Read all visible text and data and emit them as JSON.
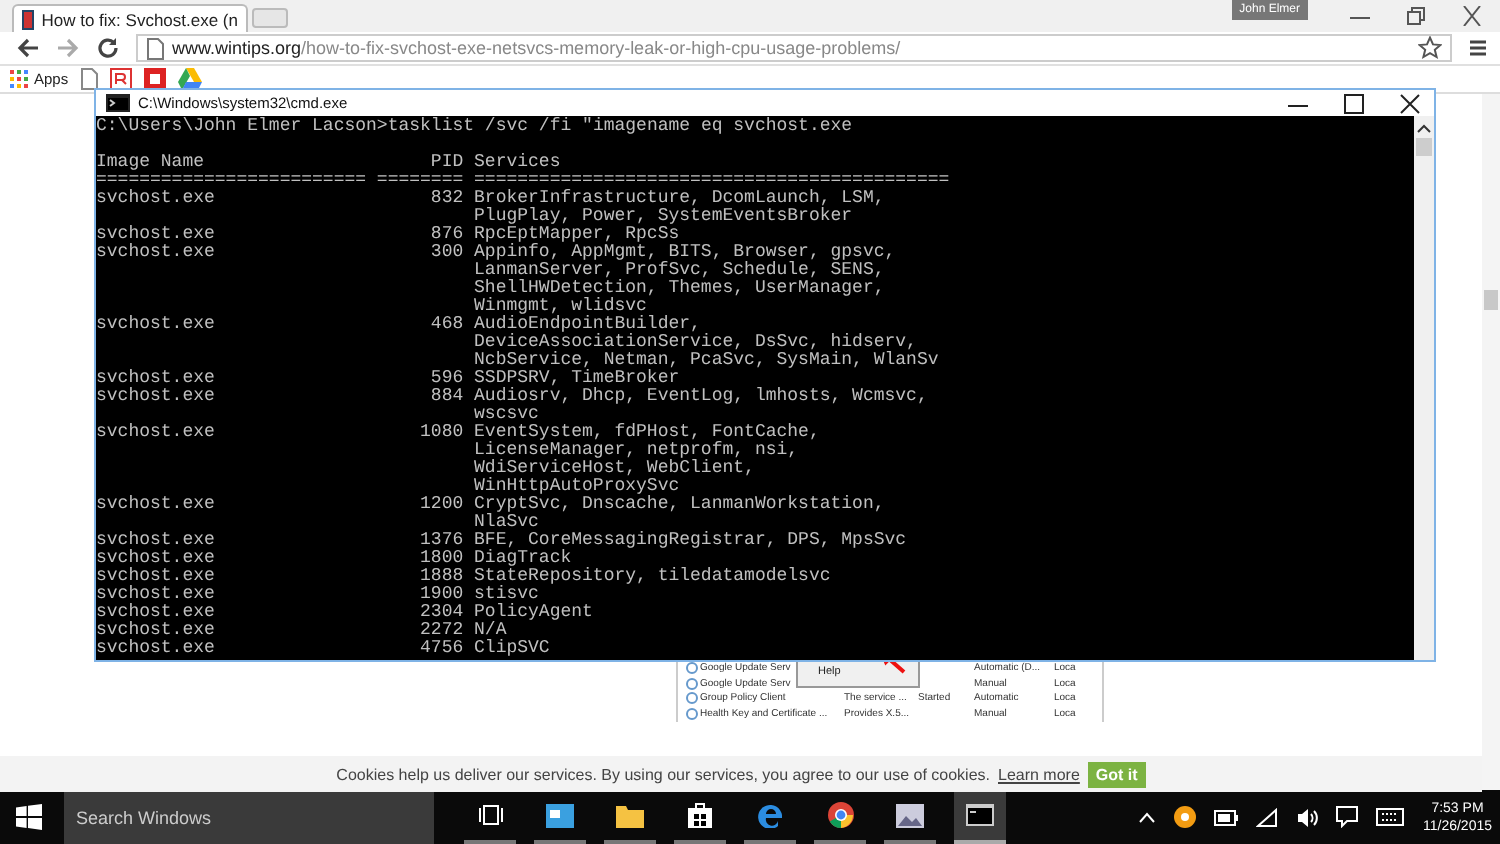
{
  "browser": {
    "tab": {
      "title": "How to fix: Svchost.exe (n"
    },
    "profile": "John Elmer",
    "address": {
      "domain": "www.wintips.org",
      "path": "/how-to-fix-svchost-exe-netsvcs-memory-leak-or-high-cpu-usage-problems/"
    },
    "bookmarks": {
      "apps_label": "Apps"
    }
  },
  "page": {
    "services_list": [
      {
        "name": "Google Update Serv",
        "startup": "Automatic (D...",
        "logon": "Loca"
      },
      {
        "name": "Google Update Serv",
        "startup": "Manual",
        "logon": "Loca"
      },
      {
        "name": "Group Policy Client",
        "description": "The service ...",
        "status": "Started",
        "startup": "Automatic",
        "logon": "Loca"
      },
      {
        "name": "Health Key and Certificate ...",
        "description": "Provides X.5...",
        "startup": "Manual",
        "logon": "Loca"
      }
    ],
    "context_menu": [
      "Help"
    ],
    "cookie_bar": {
      "text": "Cookies help us deliver our services. By using our services, you agree to our use of cookies.",
      "link": "Learn more",
      "button": "Got it"
    }
  },
  "cmd_window": {
    "title": "C:\\Windows\\system32\\cmd.exe",
    "prompt": "C:\\Users\\John Elmer Lacson>tasklist /svc /fi \"imagename eq svchost.exe",
    "columns": [
      "Image Name",
      "PID",
      "Services"
    ],
    "separators": [
      "=========================",
      "========",
      "============================================"
    ],
    "rows": [
      {
        "image": "svchost.exe",
        "pid": "832",
        "services": [
          "BrokerInfrastructure, DcomLaunch, LSM,",
          "PlugPlay, Power, SystemEventsBroker"
        ]
      },
      {
        "image": "svchost.exe",
        "pid": "876",
        "services": [
          "RpcEptMapper, RpcSs"
        ]
      },
      {
        "image": "svchost.exe",
        "pid": "300",
        "services": [
          "Appinfo, AppMgmt, BITS, Browser, gpsvc,",
          "LanmanServer, ProfSvc, Schedule, SENS,",
          "ShellHWDetection, Themes, UserManager,",
          "Winmgmt, wlidsvc"
        ]
      },
      {
        "image": "svchost.exe",
        "pid": "468",
        "services": [
          "AudioEndpointBuilder,",
          "DeviceAssociationService, DsSvc, hidserv,",
          "NcbService, Netman, PcaSvc, SysMain, WlanSv"
        ]
      },
      {
        "image": "svchost.exe",
        "pid": "596",
        "services": [
          "SSDPSRV, TimeBroker"
        ]
      },
      {
        "image": "svchost.exe",
        "pid": "884",
        "services": [
          "Audiosrv, Dhcp, EventLog, lmhosts, Wcmsvc,",
          "wscsvc"
        ]
      },
      {
        "image": "svchost.exe",
        "pid": "1080",
        "services": [
          "EventSystem, fdPHost, FontCache,",
          "LicenseManager, netprofm, nsi,",
          "WdiServiceHost, WebClient,",
          "WinHttpAutoProxySvc"
        ]
      },
      {
        "image": "svchost.exe",
        "pid": "1200",
        "services": [
          "CryptSvc, Dnscache, LanmanWorkstation,",
          "NlaSvc"
        ]
      },
      {
        "image": "svchost.exe",
        "pid": "1376",
        "services": [
          "BFE, CoreMessagingRegistrar, DPS, MpsSvc"
        ]
      },
      {
        "image": "svchost.exe",
        "pid": "1800",
        "services": [
          "DiagTrack"
        ]
      },
      {
        "image": "svchost.exe",
        "pid": "1888",
        "services": [
          "StateRepository, tiledatamodelsvc"
        ]
      },
      {
        "image": "svchost.exe",
        "pid": "1900",
        "services": [
          "stisvc"
        ]
      },
      {
        "image": "svchost.exe",
        "pid": "2304",
        "services": [
          "PolicyAgent"
        ]
      },
      {
        "image": "svchost.exe",
        "pid": "2272",
        "services": [
          "N/A"
        ]
      },
      {
        "image": "svchost.exe",
        "pid": "4756",
        "services": [
          "ClipSVC"
        ]
      }
    ]
  },
  "taskbar": {
    "search_placeholder": "Search Windows",
    "apps": [
      {
        "kind": "taskview",
        "selected": false
      },
      {
        "kind": "store-app",
        "selected": false
      },
      {
        "kind": "folder",
        "selected": false
      },
      {
        "kind": "store",
        "selected": false
      },
      {
        "kind": "edge",
        "selected": false
      },
      {
        "kind": "chrome",
        "selected": false
      },
      {
        "kind": "photos",
        "selected": false
      },
      {
        "kind": "cmd",
        "selected": true
      }
    ],
    "time": "7:53 PM",
    "date": "11/26/2015"
  }
}
